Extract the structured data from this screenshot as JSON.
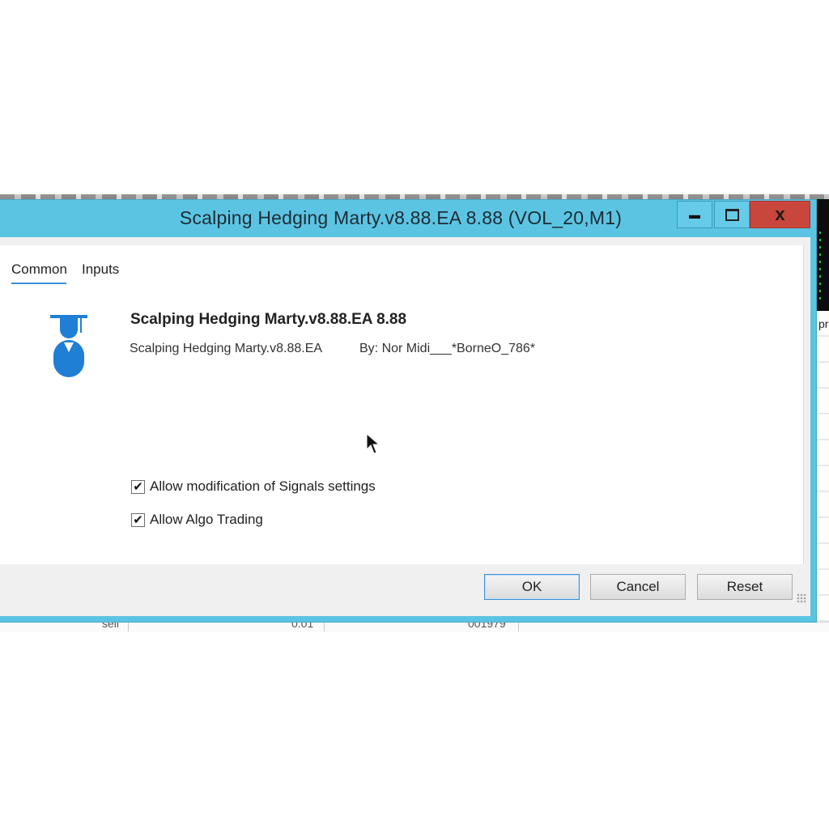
{
  "dialog": {
    "title": "Scalping Hedging Marty.v8.88.EA 8.88 (VOL_20,M1)",
    "controls": {
      "minimize": "▬",
      "close": "x"
    }
  },
  "tabs": [
    {
      "label": "Common",
      "selected": true
    },
    {
      "label": "Inputs",
      "selected": false
    }
  ],
  "ea": {
    "icon": "graduate-icon",
    "name": "Scalping Hedging Marty.v8.88.EA 8.88",
    "file": "Scalping Hedging Marty.v8.88.EA",
    "author": "By: Nor Midi___*BorneO_786*"
  },
  "options": [
    {
      "label": "Allow modification of Signals settings",
      "checked": true
    },
    {
      "label": "Allow Algo Trading",
      "checked": true
    }
  ],
  "buttons": {
    "ok": "OK",
    "cancel": "Cancel",
    "reset": "Reset"
  },
  "background": {
    "right_char": "pr",
    "row": {
      "type": "sell",
      "volume": "0.01",
      "id": "001979"
    }
  },
  "colors": {
    "titlebar": "#5cc4e3",
    "close_button": "#c9463c",
    "tab_underline": "#3c8fd6",
    "icon_blue": "#1f7fd4"
  }
}
